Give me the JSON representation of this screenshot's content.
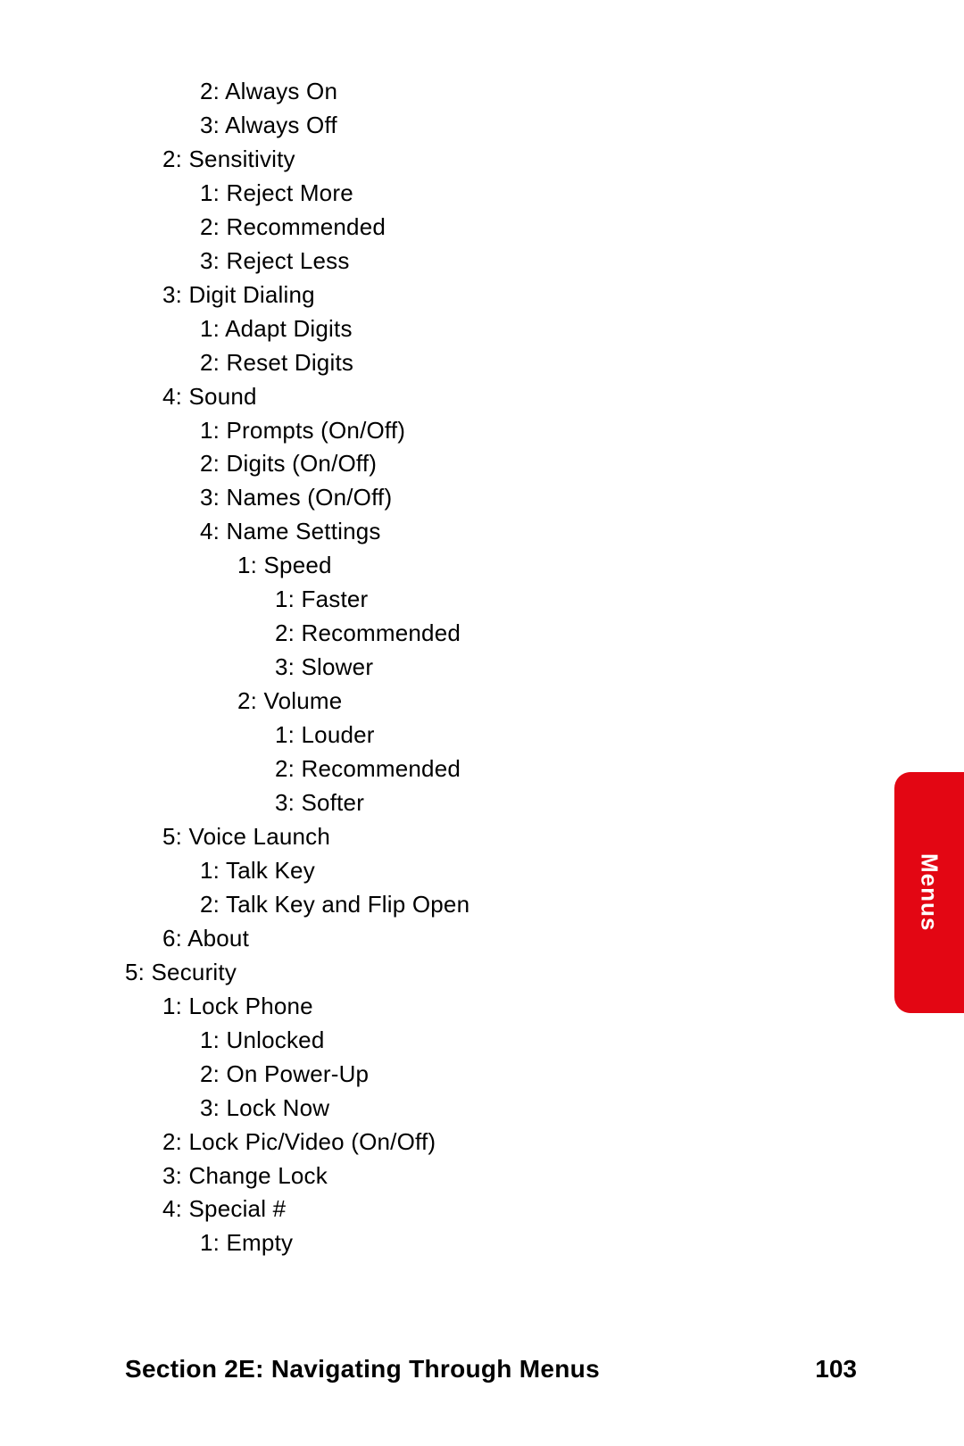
{
  "sideTab": "Menus",
  "footer": {
    "title": "Section 2E: Navigating Through Menus",
    "page": "103"
  },
  "lines": [
    {
      "indent": 2,
      "text": "2: Always On"
    },
    {
      "indent": 2,
      "text": "3: Always Off"
    },
    {
      "indent": 1,
      "text": "2: Sensitivity"
    },
    {
      "indent": 2,
      "text": "1: Reject More"
    },
    {
      "indent": 2,
      "text": "2: Recommended"
    },
    {
      "indent": 2,
      "text": "3: Reject Less"
    },
    {
      "indent": 1,
      "text": "3: Digit Dialing"
    },
    {
      "indent": 2,
      "text": "1: Adapt Digits"
    },
    {
      "indent": 2,
      "text": "2: Reset Digits"
    },
    {
      "indent": 1,
      "text": "4: Sound"
    },
    {
      "indent": 2,
      "text": "1: Prompts (On/Off)"
    },
    {
      "indent": 2,
      "text": "2: Digits (On/Off)"
    },
    {
      "indent": 2,
      "text": "3: Names (On/Off)"
    },
    {
      "indent": 2,
      "text": "4: Name Settings"
    },
    {
      "indent": 3,
      "text": "1: Speed"
    },
    {
      "indent": 4,
      "text": "1: Faster"
    },
    {
      "indent": 4,
      "text": "2: Recommended"
    },
    {
      "indent": 4,
      "text": "3: Slower"
    },
    {
      "indent": 3,
      "text": "2: Volume"
    },
    {
      "indent": 4,
      "text": "1: Louder"
    },
    {
      "indent": 4,
      "text": "2: Recommended"
    },
    {
      "indent": 4,
      "text": "3: Softer"
    },
    {
      "indent": 1,
      "text": "5: Voice Launch"
    },
    {
      "indent": 2,
      "text": "1: Talk Key"
    },
    {
      "indent": 2,
      "text": "2: Talk Key and Flip Open"
    },
    {
      "indent": 1,
      "text": "6: About"
    },
    {
      "indent": 0,
      "text": "5: Security"
    },
    {
      "indent": 1,
      "text": "1: Lock Phone"
    },
    {
      "indent": 2,
      "text": "1: Unlocked"
    },
    {
      "indent": 2,
      "text": "2: On Power-Up"
    },
    {
      "indent": 2,
      "text": "3: Lock Now"
    },
    {
      "indent": 1,
      "text": "2: Lock Pic/Video (On/Off)"
    },
    {
      "indent": 1,
      "text": "3: Change Lock"
    },
    {
      "indent": 1,
      "text": "4: Special #"
    },
    {
      "indent": 2,
      "text": "1: Empty"
    }
  ]
}
